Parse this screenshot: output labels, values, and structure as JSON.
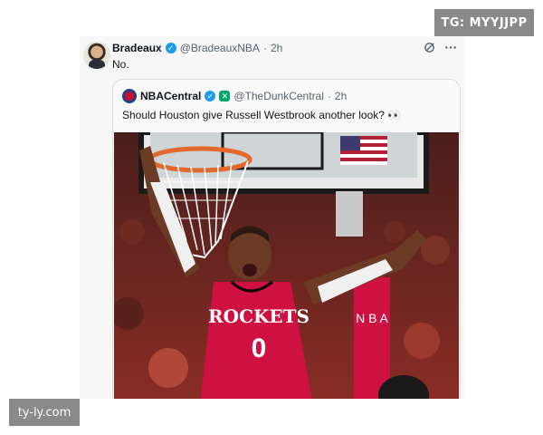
{
  "watermarks": {
    "top_right": "TG: MYYJJPP",
    "bottom_left": "ty-ly.com"
  },
  "tweet": {
    "author_name": "Bradeaux",
    "author_handle": "@BradeauxNBA",
    "time": "2h",
    "text": "No.",
    "verified": true,
    "icons": [
      "grok-icon",
      "more-icon"
    ]
  },
  "quote": {
    "author_name": "NBACentral",
    "author_handle": "@TheDunkCentral",
    "time": "2h",
    "text": "Should Houston give Russell Westbrook another look? 👀",
    "verified": true,
    "affiliate_badge": true
  },
  "photo": {
    "jersey_team": "ROCKETS",
    "jersey_number": "0",
    "stanchion_text": "N B A"
  },
  "colors": {
    "verified_blue": "#1d9bf0",
    "rockets_red": "#ce1141",
    "text_primary": "#0f1419",
    "text_secondary": "#536471"
  }
}
